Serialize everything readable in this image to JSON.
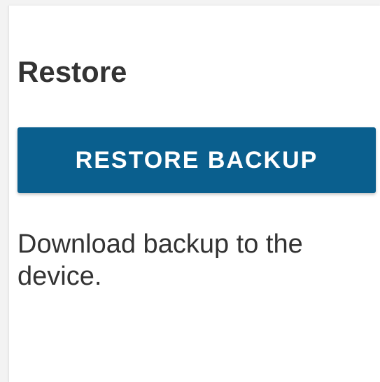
{
  "restore_section": {
    "title": "Restore",
    "button_label": "RESTORE BACKUP",
    "description": "Download backup to the device."
  },
  "colors": {
    "button_background": "#0a5f8e",
    "button_text": "#ffffff",
    "text": "#333333"
  }
}
